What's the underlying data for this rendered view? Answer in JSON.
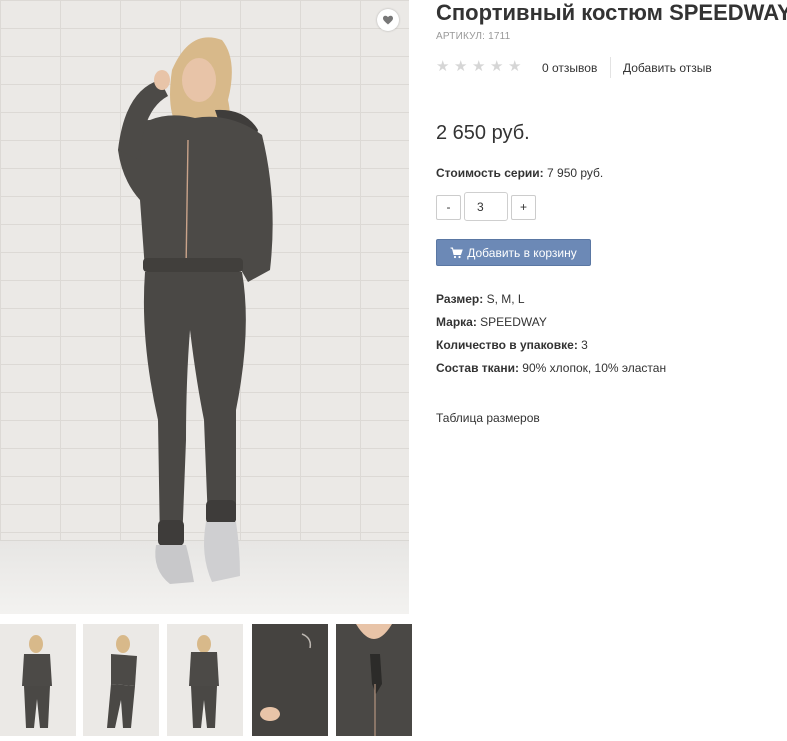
{
  "product": {
    "title": "Спортивный костюм SPEEDWAY",
    "sku": "АРТИКУЛ: 1711",
    "rating_stars": 0,
    "reviews_count": "0 отзывов",
    "add_review": "Добавить отзыв",
    "price": "2 650 руб.",
    "series_label": "Стоимость серии:",
    "series_value": "7 950 руб.",
    "quantity": "3",
    "minus_label": "-",
    "plus_label": "+",
    "add_to_cart": "Добавить в корзину",
    "size_table_link": "Таблица размеров"
  },
  "specs": [
    {
      "label": "Размер:",
      "value": "S, M, L"
    },
    {
      "label": "Марка:",
      "value": "SPEEDWAY"
    },
    {
      "label": "Количество в упаковке:",
      "value": "3"
    },
    {
      "label": "Состав ткани:",
      "value": "90% хлопок, 10% эластан"
    }
  ],
  "gallery": {
    "thumbnail_count": 5
  },
  "colors": {
    "cart_button": "#6c89b6",
    "star_empty": "#d6d6d6",
    "suit": "#4a4845"
  }
}
